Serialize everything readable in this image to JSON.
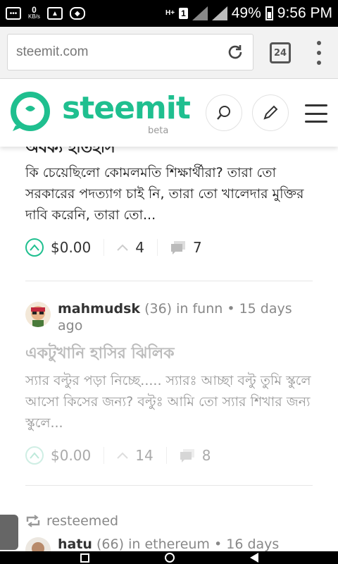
{
  "status_bar": {
    "kb_value": "0",
    "kb_unit": "KB/s",
    "network_type": "H+",
    "sim_slot": "1",
    "battery_percent": "49%",
    "time": "9:56 PM"
  },
  "browser": {
    "url": "steemit.com",
    "tab_count": "24"
  },
  "header": {
    "logo_text": "steemit",
    "logo_badge": "beta",
    "brand_color": "#1fbf8f"
  },
  "feed": {
    "cut_title": "অবক্য হাতহাস",
    "posts": [
      {
        "excerpt": "কি চেয়েছিলো কোমলমতি শিক্ষার্থীরা? তারা তো সরকারের পদত্যাগ চাই নি, তারা তো খালেদার মুক্তির দাবি করেনি, তারা তো...",
        "payout": "$0.00",
        "votes": "4",
        "comments": "7"
      },
      {
        "author": "mahmudsk",
        "reputation": "(36)",
        "category_meta": "in funn • 15 days ago",
        "title": "একটুখানি হাসির ঝিলিক",
        "excerpt": "স্যার বল্টুর পড়া নিচ্ছে..... স্যারঃ আচ্ছা বল্টু তুমি স্কুলে আসো কিসের জন্য? বল্টুঃ আমি তো স্যার শিখার জন্য স্কুলে...",
        "payout": "$0.00",
        "votes": "14",
        "comments": "8"
      },
      {
        "resteem_label": "resteemed",
        "author": "hatu",
        "reputation": "(66)",
        "category_meta": "in ethereum • 16 days"
      }
    ]
  }
}
